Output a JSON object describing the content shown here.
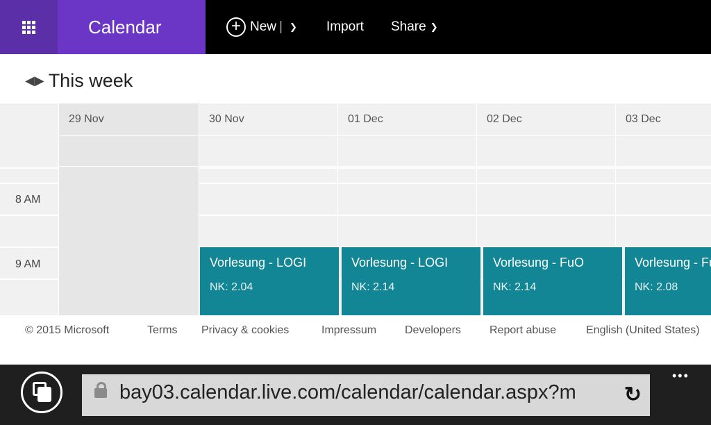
{
  "topbar": {
    "app_name": "Calendar",
    "new_label": "New",
    "new_separator": "|",
    "import_label": "Import",
    "share_label": "Share"
  },
  "header": {
    "title": "This week"
  },
  "days": [
    {
      "label": "29 Nov",
      "past": true
    },
    {
      "label": "30 Nov",
      "past": false
    },
    {
      "label": "01 Dec",
      "past": false
    },
    {
      "label": "02 Dec",
      "past": false
    },
    {
      "label": "03 Dec",
      "past": false
    }
  ],
  "times": [
    "8 AM",
    "9 AM"
  ],
  "events": [
    {
      "title": "Vorlesung - LOGI",
      "location": "NK: 2.04",
      "day": "30 Nov"
    },
    {
      "title": "Vorlesung - LOGI",
      "location": "NK: 2.14",
      "day": "01 Dec"
    },
    {
      "title": "Vorlesung - FuO",
      "location": "NK: 2.14",
      "day": "02 Dec"
    },
    {
      "title": "Vorlesung - FuO",
      "location": "NK: 2.08",
      "day": "03 Dec"
    }
  ],
  "footer": {
    "copyright": "© 2015 Microsoft",
    "terms": "Terms",
    "privacy": "Privacy & cookies",
    "impressum": "Impressum",
    "developers": "Developers",
    "report": "Report abuse",
    "language": "English (United States)"
  },
  "browser": {
    "url": "bay03.calendar.live.com/calendar/calendar.aspx?m",
    "more": "•••"
  },
  "colors": {
    "brand_dark": "#5b2fa8",
    "brand": "#6b36c6",
    "event": "#128694"
  }
}
